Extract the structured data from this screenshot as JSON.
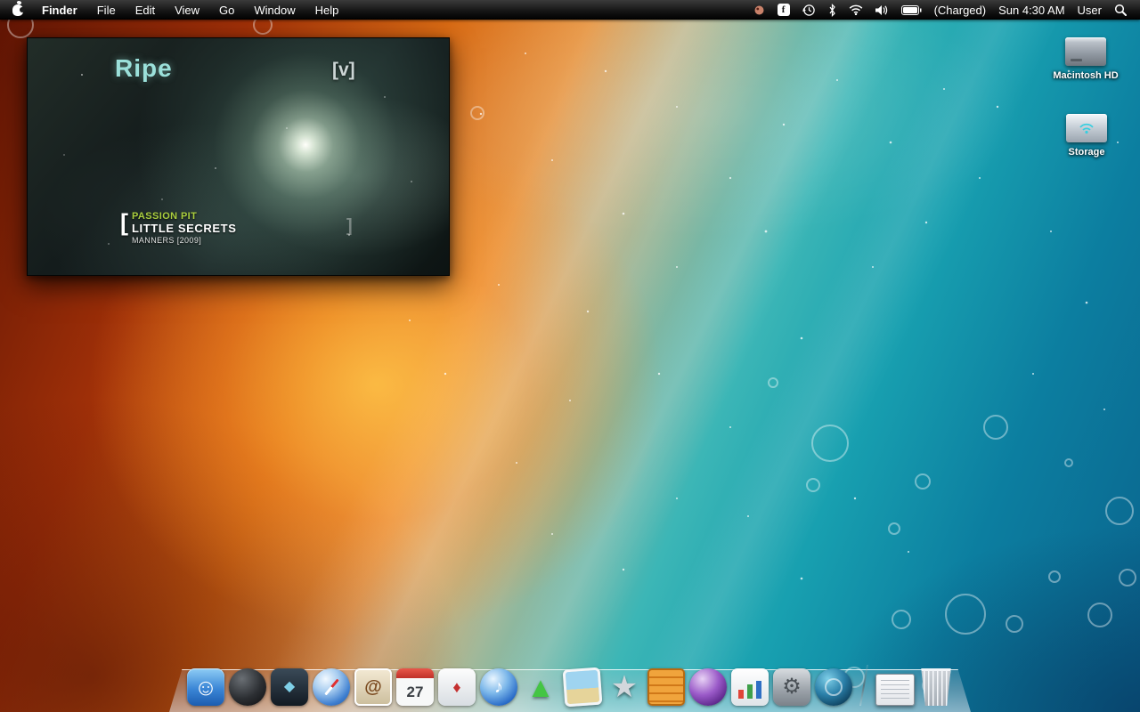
{
  "menu_bar": {
    "app_name": "Finder",
    "menus": [
      "File",
      "Edit",
      "View",
      "Go",
      "Window",
      "Help"
    ],
    "status": {
      "facebook_glyph": "f",
      "battery_label": "(Charged)",
      "clock": "Sun 4:30 AM",
      "user_name": "User"
    }
  },
  "video_window": {
    "logo": "Ripe",
    "channel_logo": "[v]",
    "bracket_left": "[",
    "bracket_right": "]",
    "artist": "PASSION PIT",
    "song": "LITTLE SECRETS",
    "album": "MANNERS [2009]"
  },
  "desktop": {
    "icons": [
      {
        "name": "macintosh-hd",
        "label": "Macintosh HD"
      },
      {
        "name": "storage",
        "label": "Storage"
      }
    ]
  },
  "dock": {
    "calendar_day": "27",
    "icons": [
      {
        "name": "finder",
        "glyph": "☺"
      },
      {
        "name": "dashboard-sphere",
        "glyph": ""
      },
      {
        "name": "dark-utility",
        "glyph": "◆"
      },
      {
        "name": "safari",
        "glyph": ""
      },
      {
        "name": "mail-stamp",
        "glyph": "@"
      },
      {
        "name": "ical",
        "glyph": ""
      },
      {
        "name": "games",
        "glyph": "♦"
      },
      {
        "name": "itunes",
        "glyph": "♪"
      },
      {
        "name": "green-arrow-upload",
        "glyph": "▲"
      },
      {
        "name": "iphoto",
        "glyph": ""
      },
      {
        "name": "star-app",
        "glyph": "★"
      },
      {
        "name": "orange-crate",
        "glyph": ""
      },
      {
        "name": "purple-orb",
        "glyph": ""
      },
      {
        "name": "chart-app",
        "glyph": ""
      },
      {
        "name": "system-preferences",
        "glyph": "⚙"
      },
      {
        "name": "search-orb",
        "glyph": ""
      },
      {
        "name": "minimized-window",
        "glyph": ""
      },
      {
        "name": "trash",
        "glyph": ""
      }
    ]
  },
  "colors": {
    "wallpaper_warm": "#d86a14",
    "wallpaper_cool": "#18a0b0",
    "ripe_logo": "#9be0da",
    "artist_green": "#aace3e",
    "menu_bar_bg": "#000000"
  }
}
